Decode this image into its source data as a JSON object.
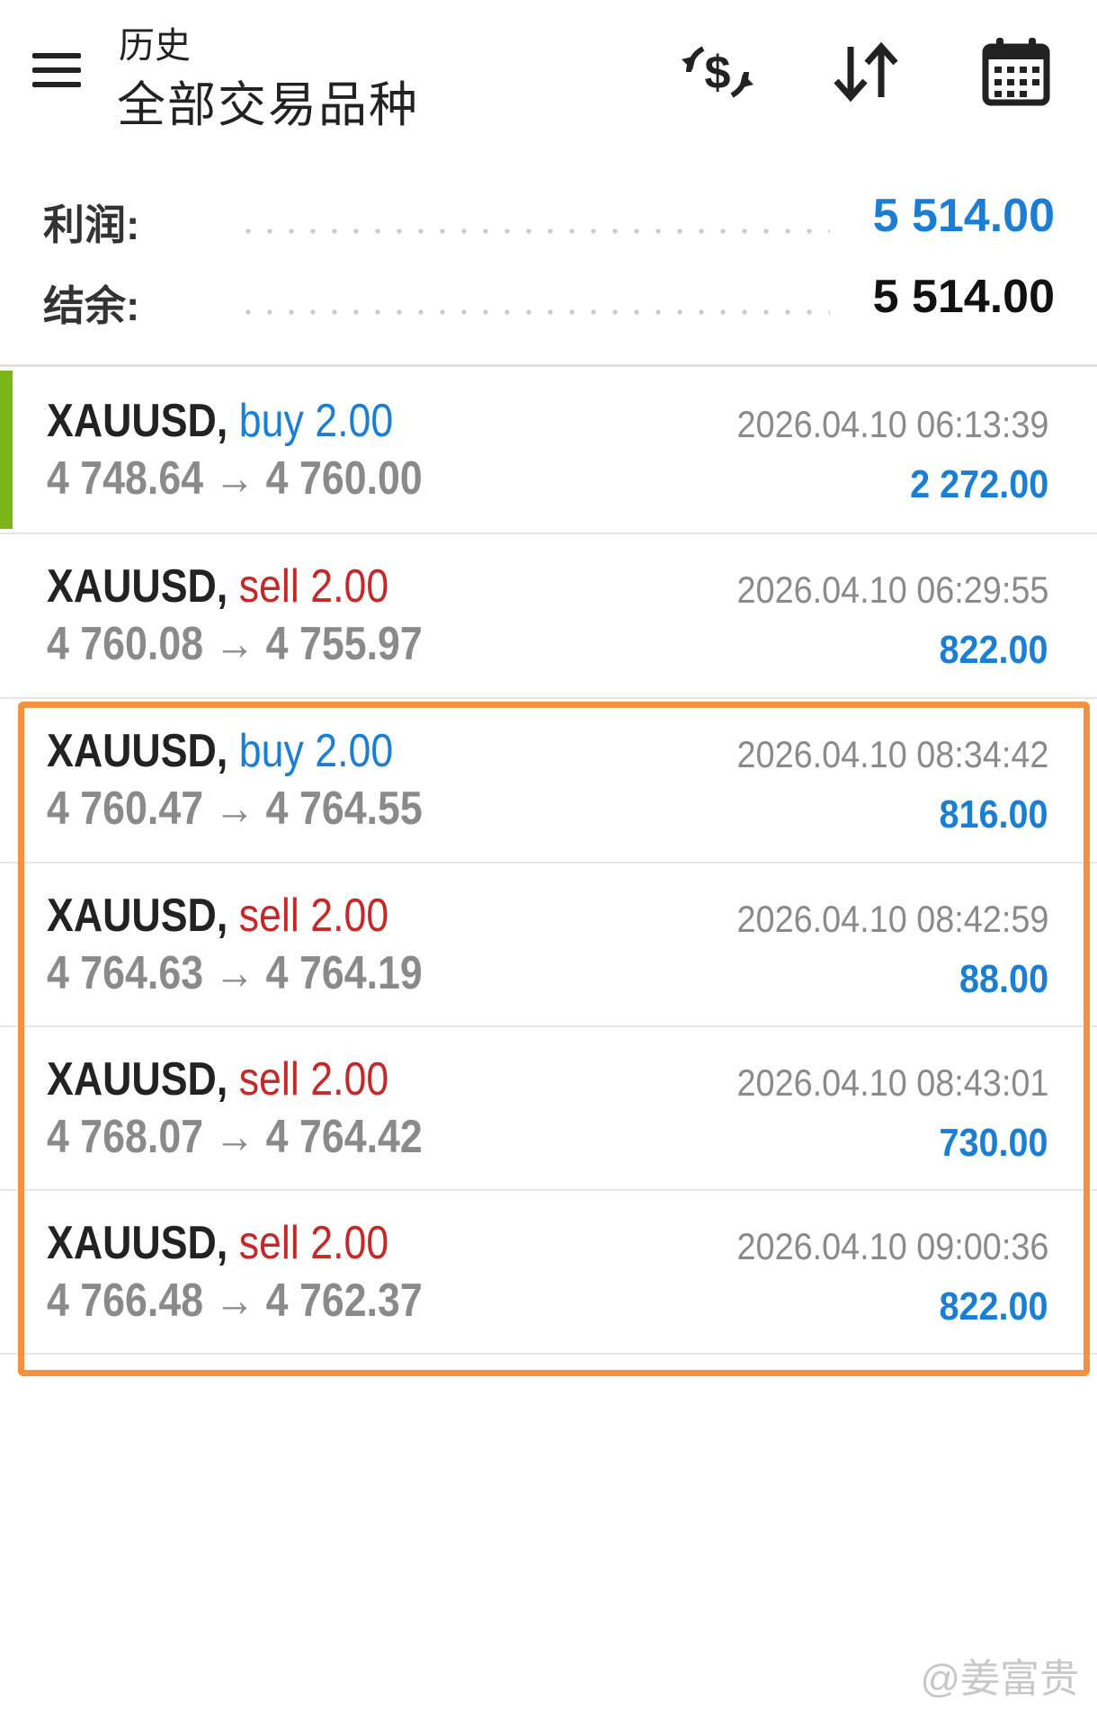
{
  "header": {
    "subtitle": "历史",
    "title": "全部交易品种",
    "icons": [
      "menu-icon",
      "currency-swap-icon",
      "sort-icon",
      "calendar-icon"
    ]
  },
  "summary": {
    "profit_label": "利润:",
    "profit_value": "5 514.00",
    "balance_label": "结余:",
    "balance_value": "5 514.00"
  },
  "deals": [
    {
      "symbol": "XAUUSD,",
      "type": "buy",
      "volume": "2.00",
      "open": "4 748.64",
      "close": "4 760.00",
      "time": "2026.04.10 06:13:39",
      "profit": "2 272.00"
    },
    {
      "symbol": "XAUUSD,",
      "type": "sell",
      "volume": "2.00",
      "open": "4 760.08",
      "close": "4 755.97",
      "time": "2026.04.10 06:29:55",
      "profit": "822.00"
    },
    {
      "symbol": "XAUUSD,",
      "type": "buy",
      "volume": "2.00",
      "open": "4 760.47",
      "close": "4 764.55",
      "time": "2026.04.10 08:34:42",
      "profit": "816.00"
    },
    {
      "symbol": "XAUUSD,",
      "type": "sell",
      "volume": "2.00",
      "open": "4 764.63",
      "close": "4 764.19",
      "time": "2026.04.10 08:42:59",
      "profit": "88.00"
    },
    {
      "symbol": "XAUUSD,",
      "type": "sell",
      "volume": "2.00",
      "open": "4 768.07",
      "close": "4 764.42",
      "time": "2026.04.10 08:43:01",
      "profit": "730.00"
    },
    {
      "symbol": "XAUUSD,",
      "type": "sell",
      "volume": "2.00",
      "open": "4 766.48",
      "close": "4 762.37",
      "time": "2026.04.10 09:00:36",
      "profit": "822.00"
    }
  ],
  "arrow": "→",
  "watermark": "@姜富贵",
  "colors": {
    "buy": "#1a7fd4",
    "sell": "#c62828",
    "profit": "#1a7fd4",
    "highlight": "#f5913e",
    "accent": "#7cb518"
  }
}
